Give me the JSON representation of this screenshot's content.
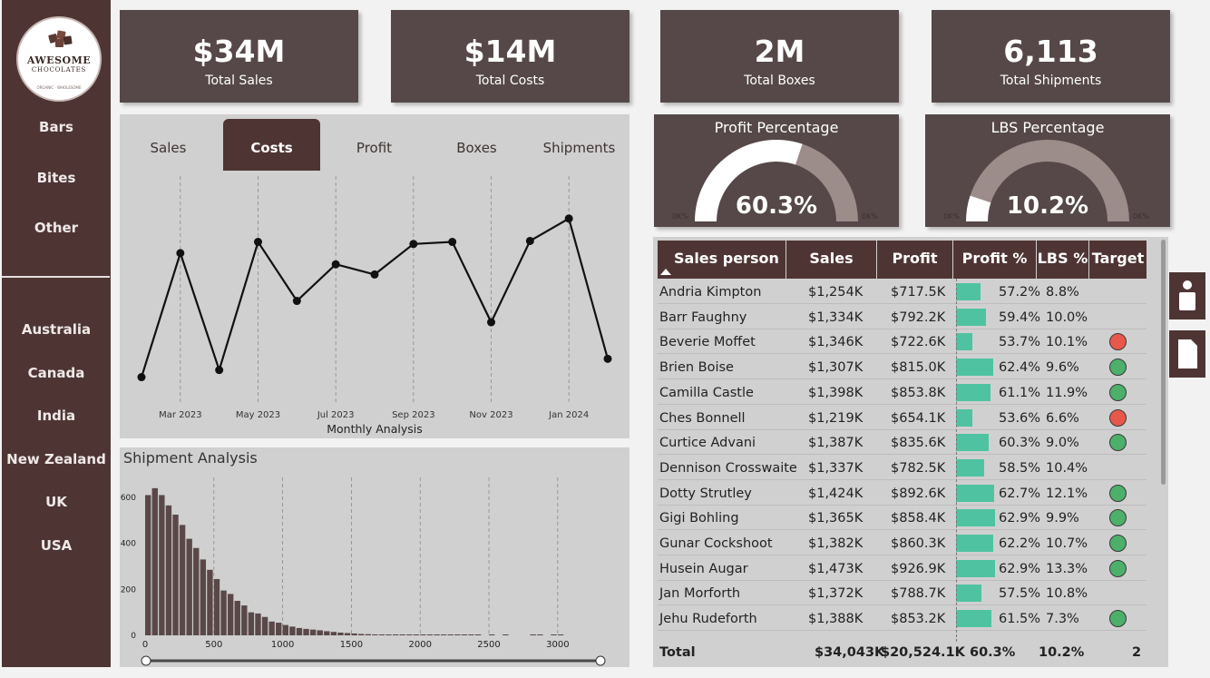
{
  "brand": {
    "line1": "AWESOME",
    "line2": "CHOCOLATES",
    "line3": "ORGANIC · WHOLESOME"
  },
  "sidebar": {
    "categories": [
      "Bars",
      "Bites",
      "Other"
    ],
    "countries": [
      "Australia",
      "Canada",
      "India",
      "New Zealand",
      "UK",
      "USA"
    ]
  },
  "kpis": [
    {
      "value": "$34M",
      "label": "Total Sales"
    },
    {
      "value": "$14M",
      "label": "Total Costs"
    },
    {
      "value": "2M",
      "label": "Total Boxes"
    },
    {
      "value": "6,113",
      "label": "Total Shipments"
    }
  ],
  "tabs": [
    "Sales",
    "Costs",
    "Profit",
    "Boxes",
    "Shipments"
  ],
  "active_tab": "Costs",
  "gauges": [
    {
      "title": "Profit Percentage",
      "value": "60.3%",
      "min": "0K%",
      "max": "0K%",
      "fraction": 0.603
    },
    {
      "title": "LBS Percentage",
      "value": "10.2%",
      "min": "0K%",
      "max": "0K%",
      "fraction": 0.102
    }
  ],
  "table": {
    "headers": [
      "Sales person",
      "Sales",
      "Profit",
      "Profit %",
      "LBS %",
      "Target"
    ],
    "rows": [
      {
        "name": "Andria Kimpton",
        "sales": "$1,254K",
        "profit": "$717.5K",
        "pct": "57.2%",
        "pct_val": 0.572,
        "lbs": "8.8%",
        "target": ""
      },
      {
        "name": "Barr Faughny",
        "sales": "$1,334K",
        "profit": "$792.2K",
        "pct": "59.4%",
        "pct_val": 0.594,
        "lbs": "10.0%",
        "target": ""
      },
      {
        "name": "Beverie Moffet",
        "sales": "$1,346K",
        "profit": "$722.6K",
        "pct": "53.7%",
        "pct_val": 0.537,
        "lbs": "10.1%",
        "target": "red"
      },
      {
        "name": "Brien Boise",
        "sales": "$1,307K",
        "profit": "$815.0K",
        "pct": "62.4%",
        "pct_val": 0.624,
        "lbs": "9.6%",
        "target": "green"
      },
      {
        "name": "Camilla Castle",
        "sales": "$1,398K",
        "profit": "$853.8K",
        "pct": "61.1%",
        "pct_val": 0.611,
        "lbs": "11.9%",
        "target": "green"
      },
      {
        "name": "Ches Bonnell",
        "sales": "$1,219K",
        "profit": "$654.1K",
        "pct": "53.6%",
        "pct_val": 0.536,
        "lbs": "6.6%",
        "target": "red"
      },
      {
        "name": "Curtice Advani",
        "sales": "$1,387K",
        "profit": "$835.6K",
        "pct": "60.3%",
        "pct_val": 0.603,
        "lbs": "9.0%",
        "target": "green"
      },
      {
        "name": "Dennison Crosswaite",
        "sales": "$1,337K",
        "profit": "$782.5K",
        "pct": "58.5%",
        "pct_val": 0.585,
        "lbs": "10.4%",
        "target": ""
      },
      {
        "name": "Dotty Strutley",
        "sales": "$1,424K",
        "profit": "$892.6K",
        "pct": "62.7%",
        "pct_val": 0.627,
        "lbs": "12.1%",
        "target": "green"
      },
      {
        "name": "Gigi Bohling",
        "sales": "$1,365K",
        "profit": "$858.4K",
        "pct": "62.9%",
        "pct_val": 0.629,
        "lbs": "9.9%",
        "target": "green"
      },
      {
        "name": "Gunar Cockshoot",
        "sales": "$1,382K",
        "profit": "$860.3K",
        "pct": "62.2%",
        "pct_val": 0.622,
        "lbs": "10.7%",
        "target": "green"
      },
      {
        "name": "Husein Augar",
        "sales": "$1,473K",
        "profit": "$926.9K",
        "pct": "62.9%",
        "pct_val": 0.629,
        "lbs": "13.3%",
        "target": "green"
      },
      {
        "name": "Jan Morforth",
        "sales": "$1,372K",
        "profit": "$788.7K",
        "pct": "57.5%",
        "pct_val": 0.575,
        "lbs": "10.8%",
        "target": ""
      },
      {
        "name": "Jehu Rudeforth",
        "sales": "$1,388K",
        "profit": "$853.2K",
        "pct": "61.5%",
        "pct_val": 0.615,
        "lbs": "7.3%",
        "target": "green"
      }
    ],
    "totals": {
      "label": "Total",
      "sales": "$34,043K",
      "profit": "$20,524.1K",
      "pct": "60.3%",
      "lbs": "10.2%",
      "target": "2"
    }
  },
  "colors": {
    "brown": "#4e3533",
    "kpi": "#564848",
    "teal": "#4fc3a1",
    "red": "#e8574b",
    "green": "#4caf6a"
  },
  "chart_data": [
    {
      "type": "line",
      "xlabel": "Monthly Analysis",
      "x_ticks": [
        "Mar 2023",
        "May 2023",
        "Jul 2023",
        "Sep 2023",
        "Nov 2023",
        "Jan 2024"
      ],
      "x": [
        "Feb 2023",
        "Mar 2023",
        "Apr 2023",
        "May 2023",
        "Jun 2023",
        "Jul 2023",
        "Aug 2023",
        "Sep 2023",
        "Oct 2023",
        "Nov 2023",
        "Dec 2023",
        "Jan 2024",
        "Feb 2024"
      ],
      "values": [
        0.2,
        6.3,
        0.55,
        6.85,
        3.95,
        5.75,
        5.25,
        6.75,
        6.85,
        2.9,
        6.9,
        8.0,
        1.1
      ],
      "ylim": [
        0,
        10
      ]
    },
    {
      "type": "bar",
      "title": "Shipment Analysis",
      "y_ticks": [
        "600",
        "400",
        "200",
        "0"
      ],
      "x_ticks": [
        "0",
        "500",
        "1000",
        "1500",
        "2000",
        "2500",
        "3000"
      ],
      "xlim": [
        0,
        3100
      ],
      "ylim": [
        0,
        600
      ],
      "bin_width": 50,
      "values": [
        610,
        640,
        610,
        565,
        525,
        480,
        420,
        380,
        330,
        285,
        245,
        195,
        180,
        150,
        130,
        100,
        95,
        80,
        60,
        55,
        45,
        38,
        32,
        28,
        25,
        22,
        18,
        15,
        12,
        10,
        8,
        6,
        5,
        4,
        3,
        3,
        2,
        2,
        2,
        1,
        1,
        1,
        1,
        1,
        1,
        1,
        1,
        1,
        1,
        0,
        1,
        0,
        1,
        0,
        0,
        0,
        1,
        1,
        0,
        1,
        1,
        0
      ]
    }
  ]
}
